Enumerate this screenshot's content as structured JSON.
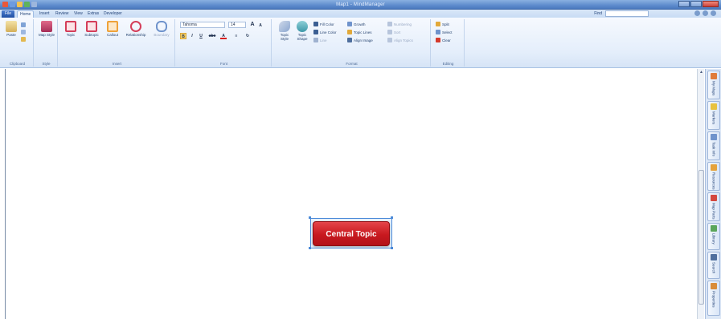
{
  "window": {
    "title": "Map1 - MindManager",
    "controls": [
      "minimize",
      "maximize",
      "close"
    ],
    "quick_access": [
      "app-icon",
      "save-icon",
      "undo-icon",
      "redo-icon",
      "print-icon"
    ]
  },
  "tabs": [
    {
      "label": "File",
      "active": false
    },
    {
      "label": "Home",
      "active": true
    },
    {
      "label": "Insert",
      "active": false
    },
    {
      "label": "Review",
      "active": false
    },
    {
      "label": "View",
      "active": false
    },
    {
      "label": "Extras",
      "active": false
    },
    {
      "label": "Developer",
      "active": false
    }
  ],
  "find": {
    "label": "Find",
    "value": ""
  },
  "ribbon": {
    "clipboard": {
      "label": "Clipboard",
      "paste": "Paste"
    },
    "style": {
      "label": "Style",
      "map_style": "Map Style"
    },
    "insert": {
      "label": "Insert",
      "topic": "Topic",
      "subtopic": "Subtopic",
      "callout": "Callout",
      "relationship": "Relationship",
      "boundary": "Boundary"
    },
    "font": {
      "label": "Font",
      "family": "Tahoma",
      "size": "14",
      "bold": "B",
      "italic": "I",
      "underline": "U",
      "strike": "abc",
      "grow": "A",
      "shrink": "A"
    },
    "format": {
      "label": "Format",
      "topic_style": "Topic Style",
      "topic_shape": "Topic Shape",
      "fill_color": "Fill Color",
      "line_color": "Line Color",
      "line": "Line",
      "growth": "Growth",
      "topic_lines": "Topic Lines",
      "align_image": "Align Image",
      "numbering": "Numbering",
      "sort": "Sort",
      "align_topics": "Align Topics"
    },
    "editing": {
      "label": "Editing",
      "split": "Split",
      "select": "Select",
      "clear": "Clear"
    }
  },
  "side_panel": [
    {
      "label": "My Maps",
      "icon": "my-maps-icon"
    },
    {
      "label": "Markers",
      "icon": "markers-icon"
    },
    {
      "label": "Task Info",
      "icon": "task-info-icon"
    },
    {
      "label": "Resources",
      "icon": "resources-icon"
    },
    {
      "label": "Map Parts",
      "icon": "map-parts-icon"
    },
    {
      "label": "Library",
      "icon": "library-icon"
    },
    {
      "label": "Search",
      "icon": "search-icon"
    },
    {
      "label": "Properties",
      "icon": "properties-icon"
    }
  ],
  "map": {
    "central_topic": "Central Topic"
  },
  "colors": {
    "topic_fill": "#c8191f",
    "ribbon_bg": "#e4eefb",
    "titlebar": "#5e8ccd",
    "selection": "#4b8ad8"
  }
}
